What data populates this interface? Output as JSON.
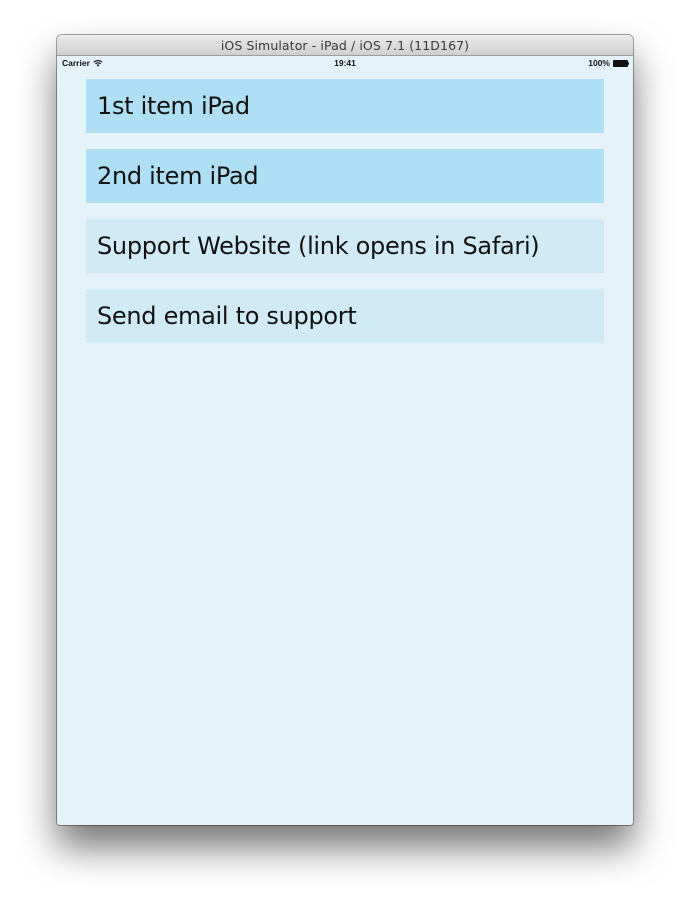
{
  "window": {
    "title": "iOS Simulator - iPad / iOS 7.1 (11D167)"
  },
  "statusbar": {
    "carrier": "Carrier",
    "wifi_icon": "wifi-icon",
    "time": "19:41",
    "battery_percent": "100%",
    "battery_icon": "battery-icon"
  },
  "colors": {
    "screen_background": "#e4f3fa",
    "item_primary": "#afdff5",
    "item_secondary": "#d0ebf6"
  },
  "list": {
    "items": [
      {
        "label": "1st item iPad",
        "style": "primary"
      },
      {
        "label": "2nd item iPad",
        "style": "primary"
      },
      {
        "label": "Support Website (link opens in Safari)",
        "style": "secondary"
      },
      {
        "label": "Send email to support",
        "style": "secondary"
      }
    ]
  }
}
